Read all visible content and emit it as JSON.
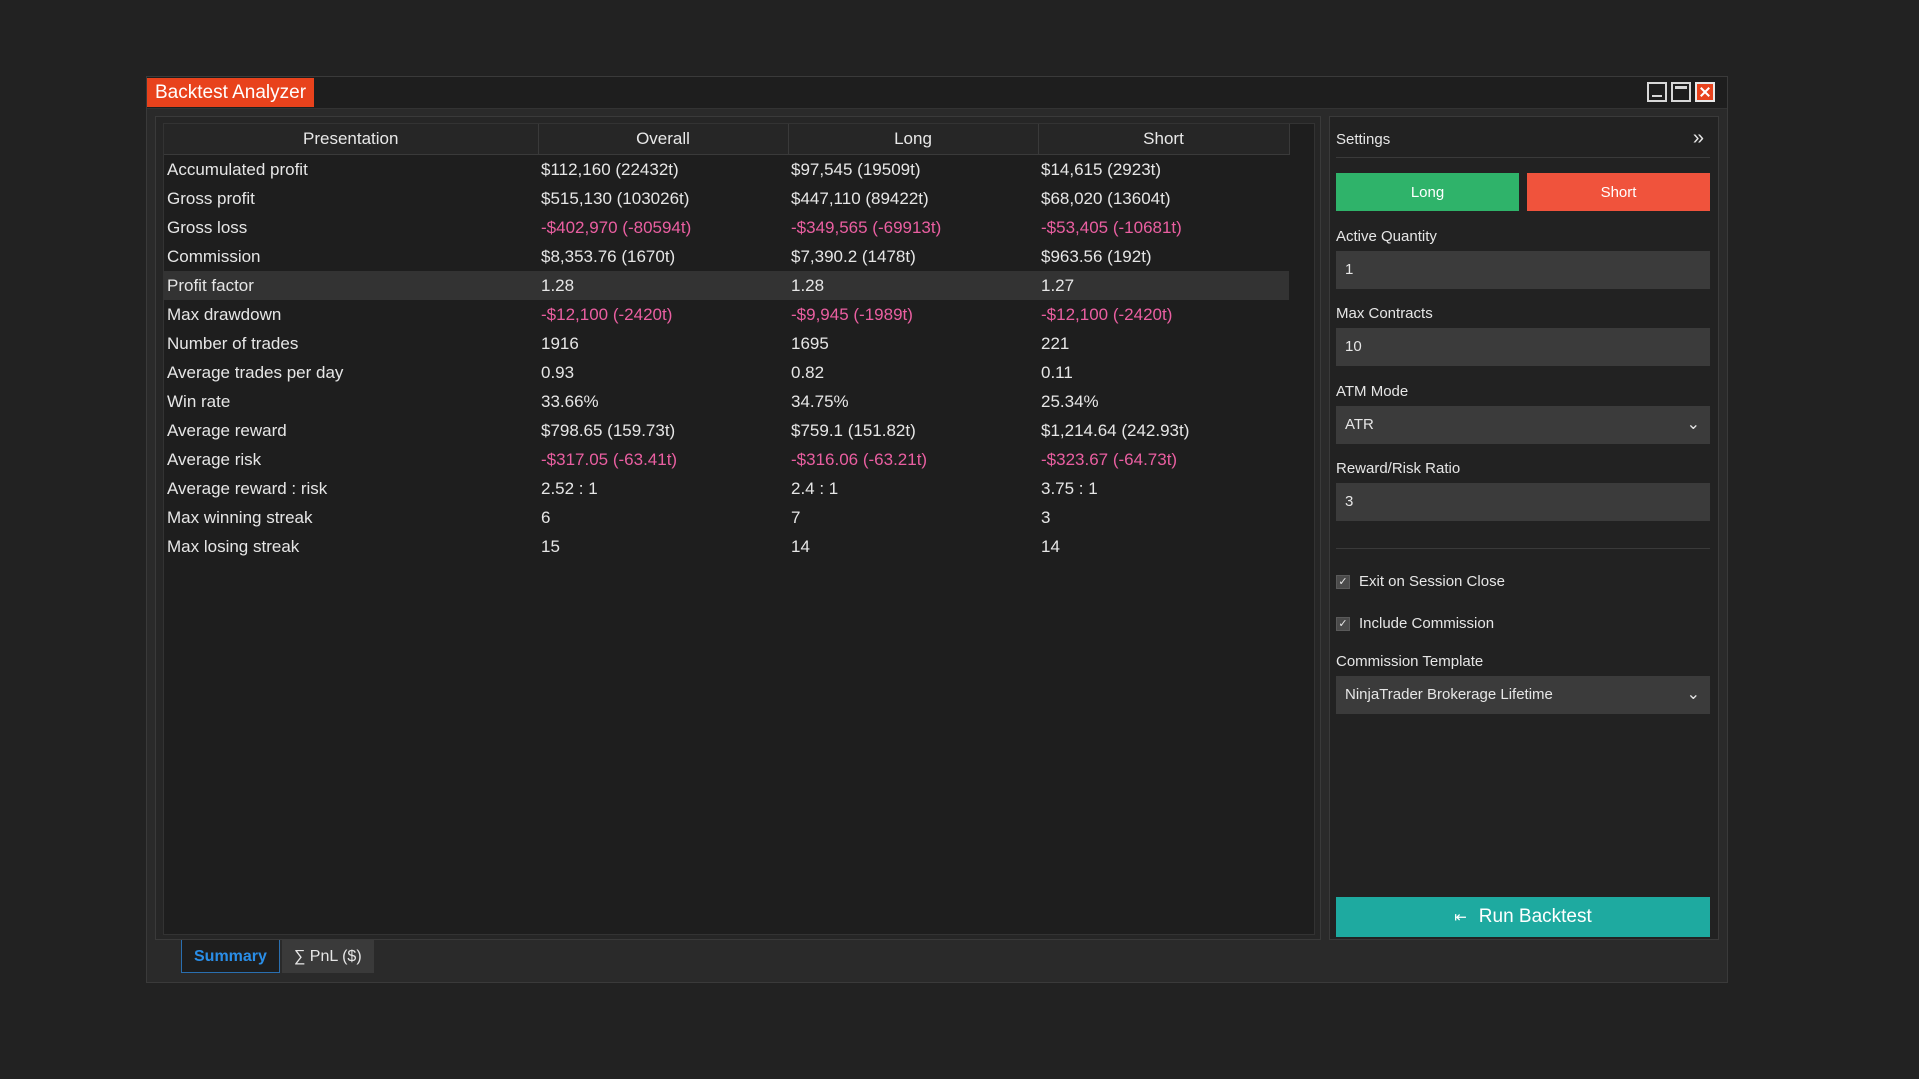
{
  "window": {
    "title": "Backtest Analyzer",
    "controls": {
      "minimize": "minimize-icon",
      "maximize": "maximize-icon",
      "close": "close-icon"
    }
  },
  "table": {
    "columns": [
      "Presentation",
      "Overall",
      "Long",
      "Short"
    ],
    "rows": [
      {
        "label": "Accumulated profit",
        "overall": "$112,160 (22432t)",
        "long": "$97,545 (19509t)",
        "short": "$14,615 (2923t)",
        "negative": false
      },
      {
        "label": "Gross profit",
        "overall": "$515,130 (103026t)",
        "long": "$447,110 (89422t)",
        "short": "$68,020 (13604t)",
        "negative": false
      },
      {
        "label": "Gross loss",
        "overall": "-$402,970 (-80594t)",
        "long": "-$349,565 (-69913t)",
        "short": "-$53,405 (-10681t)",
        "negative": true
      },
      {
        "label": "Commission",
        "overall": "$8,353.76 (1670t)",
        "long": "$7,390.2 (1478t)",
        "short": "$963.56 (192t)",
        "negative": false
      },
      {
        "label": "Profit factor",
        "overall": "1.28",
        "long": "1.28",
        "short": "1.27",
        "negative": false,
        "selected": true
      },
      {
        "label": "Max drawdown",
        "overall": "-$12,100 (-2420t)",
        "long": "-$9,945 (-1989t)",
        "short": "-$12,100 (-2420t)",
        "negative": true
      },
      {
        "label": "Number of trades",
        "overall": "1916",
        "long": "1695",
        "short": "221",
        "negative": false
      },
      {
        "label": "Average trades per day",
        "overall": "0.93",
        "long": "0.82",
        "short": "0.11",
        "negative": false
      },
      {
        "label": "Win rate",
        "overall": "33.66%",
        "long": "34.75%",
        "short": "25.34%",
        "negative": false
      },
      {
        "label": "Average reward",
        "overall": "$798.65 (159.73t)",
        "long": "$759.1 (151.82t)",
        "short": "$1,214.64 (242.93t)",
        "negative": false
      },
      {
        "label": "Average risk",
        "overall": "-$317.05 (-63.41t)",
        "long": "-$316.06 (-63.21t)",
        "short": "-$323.67 (-64.73t)",
        "negative": true
      },
      {
        "label": "Average reward : risk",
        "overall": "2.52 : 1",
        "long": "2.4 : 1",
        "short": "3.75 : 1",
        "negative": false
      },
      {
        "label": "Max winning streak",
        "overall": "6",
        "long": "7",
        "short": "3",
        "negative": false
      },
      {
        "label": "Max losing streak",
        "overall": "15",
        "long": "14",
        "short": "14",
        "negative": false
      }
    ]
  },
  "tabs": [
    {
      "label": "Summary",
      "active": true
    },
    {
      "label": "∑ PnL ($)",
      "active": false
    }
  ],
  "settings": {
    "title": "Settings",
    "collapse_icon": "»",
    "long_label": "Long",
    "short_label": "Short",
    "active_quantity": {
      "label": "Active Quantity",
      "value": "1"
    },
    "max_contracts": {
      "label": "Max Contracts",
      "value": "10"
    },
    "atm_mode": {
      "label": "ATM Mode",
      "value": "ATR"
    },
    "reward_risk": {
      "label": "Reward/Risk Ratio",
      "value": "3"
    },
    "exit_on_session_close": {
      "label": "Exit on Session Close",
      "checked": true
    },
    "include_commission": {
      "label": "Include Commission",
      "checked": true
    },
    "commission_template": {
      "label": "Commission Template",
      "value": "NinjaTrader Brokerage Lifetime"
    },
    "run_label": "Run Backtest",
    "colors": {
      "long": "#2fb36a",
      "short": "#f0533c",
      "run": "#1eaaa0",
      "negative_text": "#ea5fa1",
      "title_accent": "#e8421c"
    }
  }
}
